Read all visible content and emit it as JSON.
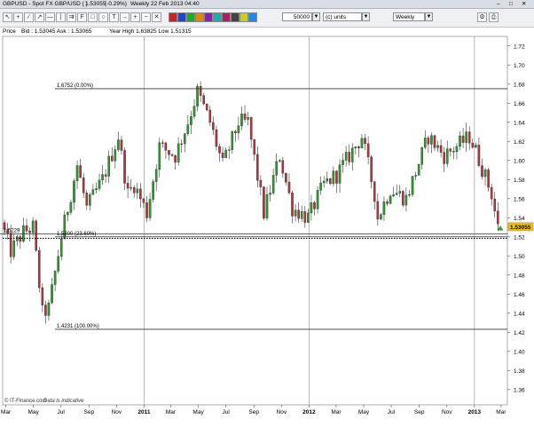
{
  "window": {
    "title": "GBPUSD - Spot FX GBP/USD ( )",
    "price": "1.53055",
    "change": "(-0.29%)",
    "period": "Weekly",
    "date": "22 Feb 2013 04:40"
  },
  "toolbar": {
    "quantity": "50000",
    "unit_selector": "(c) units",
    "timeframe": "Weekly",
    "swatch_colors": [
      "#cc2222",
      "#2244cc",
      "#22aa22",
      "#dd8800",
      "#8822aa",
      "#22aaaa",
      "#aa2266",
      "#444444",
      "#cccc22",
      "#2288ee"
    ]
  },
  "info": {
    "price_tab": "Price",
    "bid_ask": "Bid : 1.53045 Ask : 1.53065",
    "year_range": "Year High 1.63825 Low 1.51315"
  },
  "footer": {
    "source": "© IT-Finance.com",
    "note": "Data is indicative"
  },
  "chart_data": {
    "type": "candlestick",
    "y_ticks": [
      1.36,
      1.38,
      1.4,
      1.42,
      1.44,
      1.46,
      1.48,
      1.5,
      1.52,
      1.54,
      1.56,
      1.58,
      1.6,
      1.62,
      1.64,
      1.66,
      1.68,
      1.7,
      1.72
    ],
    "ylim": [
      1.344,
      1.73
    ],
    "last_price_label": "1.53055",
    "x_labels": [
      "Mar",
      "May",
      "Jul",
      "Sep",
      "Nov",
      "2011",
      "Mar",
      "May",
      "Jul",
      "Sep",
      "Nov",
      "2012",
      "Mar",
      "May",
      "Jul",
      "Sep",
      "Nov",
      "2013",
      "Mar"
    ],
    "x_range": [
      "2010-02-22",
      "2013-03-15"
    ],
    "x_label_dates": [
      "2010-03-01",
      "2010-05-01",
      "2010-07-01",
      "2010-09-01",
      "2010-11-01",
      "2011-01-01",
      "2011-03-01",
      "2011-05-01",
      "2011-07-01",
      "2011-09-01",
      "2011-11-01",
      "2012-01-01",
      "2012-03-01",
      "2012-05-01",
      "2012-07-01",
      "2012-09-01",
      "2012-11-01",
      "2013-01-01",
      "2013-03-01"
    ],
    "year_lines": [
      "2011-01-01",
      "2012-01-01",
      "2013-01-01"
    ],
    "fib_levels": [
      {
        "label": "1.6752 (0.00%)",
        "value": 1.6752
      },
      {
        "label": "1.5229",
        "value": 1.5229
      },
      {
        "label": "1.5200 (23.60%)",
        "value": 1.52
      },
      {
        "label": "1.4231 (100.00%)",
        "value": 1.4231
      }
    ],
    "bull_color": "#2e9a2e",
    "bear_color": "#b8343e",
    "close_anchors": [
      [
        "2010-02-26",
        1.525
      ],
      [
        "2010-03-12",
        1.505
      ],
      [
        "2010-04-09",
        1.525
      ],
      [
        "2010-04-30",
        1.53
      ],
      [
        "2010-05-21",
        1.44
      ],
      [
        "2010-06-04",
        1.445
      ],
      [
        "2010-07-02",
        1.52
      ],
      [
        "2010-08-06",
        1.595
      ],
      [
        "2010-08-27",
        1.55
      ],
      [
        "2010-10-01",
        1.58
      ],
      [
        "2010-11-05",
        1.625
      ],
      [
        "2010-11-26",
        1.565
      ],
      [
        "2010-12-10",
        1.575
      ],
      [
        "2011-01-07",
        1.545
      ],
      [
        "2011-02-04",
        1.615
      ],
      [
        "2011-03-11",
        1.605
      ],
      [
        "2011-04-08",
        1.64
      ],
      [
        "2011-04-29",
        1.672
      ],
      [
        "2011-05-27",
        1.64
      ],
      [
        "2011-06-24",
        1.595
      ],
      [
        "2011-07-29",
        1.64
      ],
      [
        "2011-08-19",
        1.64
      ],
      [
        "2011-09-23",
        1.545
      ],
      [
        "2011-10-28",
        1.605
      ],
      [
        "2011-11-25",
        1.55
      ],
      [
        "2011-12-30",
        1.54
      ],
      [
        "2012-02-03",
        1.575
      ],
      [
        "2012-03-02",
        1.585
      ],
      [
        "2012-04-27",
        1.625
      ],
      [
        "2012-05-25",
        1.565
      ],
      [
        "2012-06-01",
        1.54
      ],
      [
        "2012-06-29",
        1.57
      ],
      [
        "2012-08-03",
        1.56
      ],
      [
        "2012-09-21",
        1.625
      ],
      [
        "2012-10-26",
        1.605
      ],
      [
        "2012-12-21",
        1.625
      ],
      [
        "2013-01-04",
        1.61
      ],
      [
        "2013-02-08",
        1.565
      ],
      [
        "2013-02-22",
        1.53
      ]
    ]
  }
}
